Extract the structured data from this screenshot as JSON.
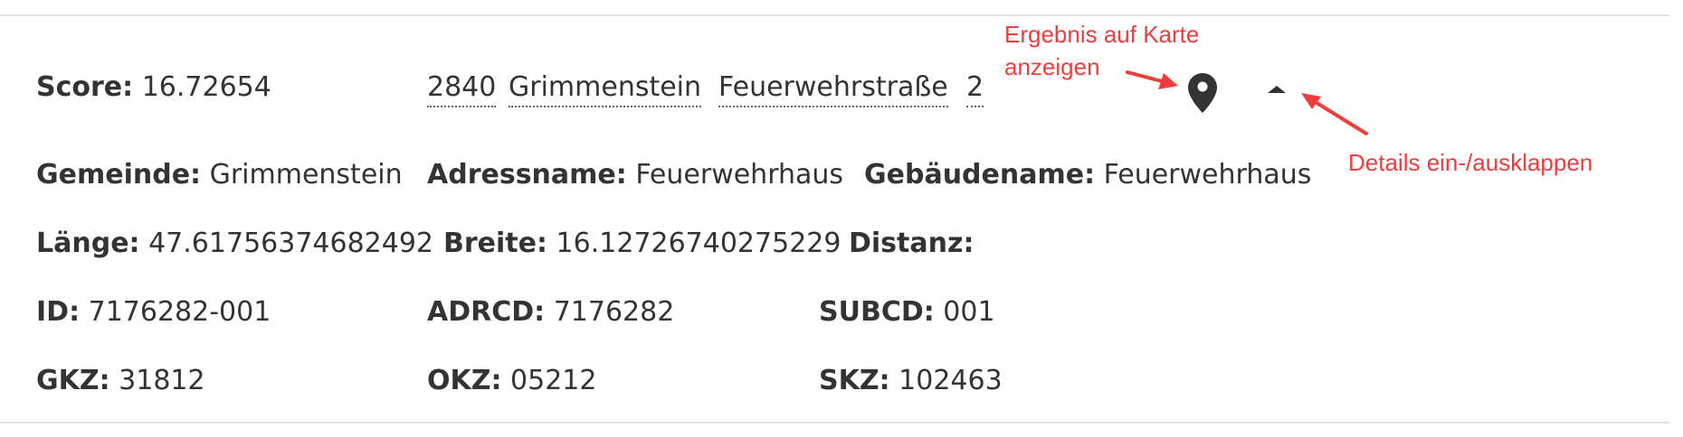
{
  "result": {
    "score": {
      "label": "Score:",
      "value": "16.72654"
    },
    "address_parts": [
      "2840",
      "Grimmenstein",
      "Feuerwehrstraße",
      "2"
    ],
    "map_button": {
      "icon": "map-marker-icon"
    },
    "toggle_button": {
      "icon": "caret-up-icon"
    },
    "details": {
      "gemeinde": {
        "label": "Gemeinde:",
        "value": "Grimmenstein"
      },
      "adressname": {
        "label": "Adressname:",
        "value": "Feuerwehrhaus"
      },
      "gebaeudename": {
        "label": "Gebäudename:",
        "value": "Feuerwehrhaus"
      },
      "laenge": {
        "label": "Länge:",
        "value": "47.61756374682492"
      },
      "breite": {
        "label": "Breite:",
        "value": "16.12726740275229"
      },
      "distanz": {
        "label": "Distanz:",
        "value": ""
      },
      "id": {
        "label": "ID:",
        "value": "7176282-001"
      },
      "adrcd": {
        "label": "ADRCD:",
        "value": "7176282"
      },
      "subcd": {
        "label": "SUBCD:",
        "value": "001"
      },
      "gkz": {
        "label": "GKZ:",
        "value": "31812"
      },
      "okz": {
        "label": "OKZ:",
        "value": "05212"
      },
      "skz": {
        "label": "SKZ:",
        "value": "102463"
      }
    }
  },
  "annotations": {
    "map_note_line1": "Ergebnis auf Karte",
    "map_note_line2": "anzeigen",
    "toggle_note": "Details ein-/ausklappen"
  },
  "colors": {
    "text": "#333333",
    "annotation": "#f03c3c",
    "rule": "#e2e2e2"
  }
}
